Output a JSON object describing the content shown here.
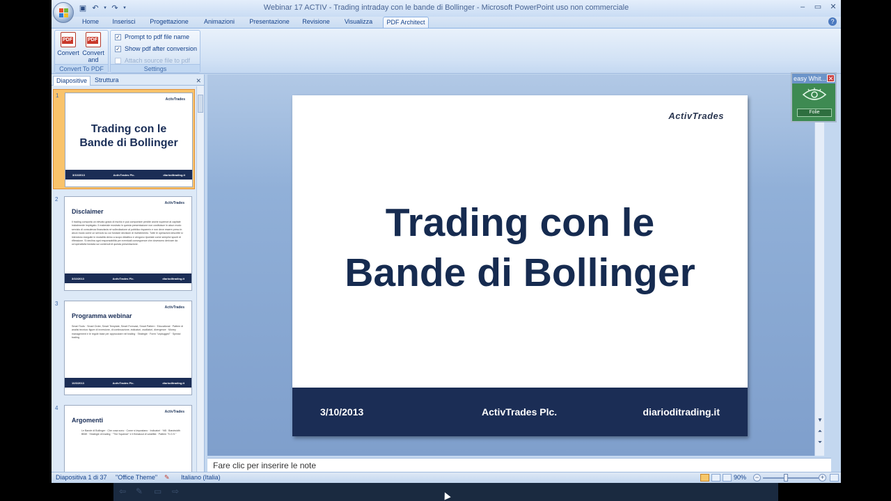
{
  "window": {
    "title": "Webinar 17  ACTIV - Trading intraday con le bande di Bollinger - Microsoft PowerPoint uso non commerciale"
  },
  "ribbon_tabs": [
    "Home",
    "Inserisci",
    "Progettazione",
    "Animazioni",
    "Presentazione",
    "Revisione",
    "Visualizza",
    "PDF Architect"
  ],
  "active_tab": "PDF Architect",
  "ribbon": {
    "convert_label": "Convert",
    "convert_mail_label": "Convert and Mail",
    "group1_label": "Convert To PDF",
    "checks": [
      {
        "label": "Prompt to pdf file name",
        "checked": true,
        "enabled": true
      },
      {
        "label": "Show pdf after conversion",
        "checked": true,
        "enabled": true
      },
      {
        "label": "Attach source file to pdf",
        "checked": false,
        "enabled": false
      }
    ],
    "group2_label": "Settings"
  },
  "left_pane": {
    "tabs": [
      "Diapositive",
      "Struttura"
    ],
    "thumbnails": [
      {
        "num": "1",
        "kind": "title",
        "title": "Trading con le Bande di Bollinger",
        "date": "3/10/2013",
        "company": "ActivTrades Plc.",
        "site": "diarioditrading.it"
      },
      {
        "num": "2",
        "kind": "text",
        "title": "Disclaimer",
        "body": "Il trading comporta un elevato grado di rischio e può comportare perdite anche superiori al capitale inizialmente impiegato. Il materiale mostrato in questa presentazione non costituisce in alcun modo servizio di consulenza finanziaria né sollecitazione al pubblico risparmio e non deve essere preso in alcun modo come un servizio su cui fondare decisioni di investimento. Tutte le operazioni descritte si intendono eseguite in modalità demo a scopo didattico e vengono riportate come semplici spunti di riflessione. Si declina ogni responsabilità per eventuali conseguenze che dovessero derivare da un'operatività fondata sui contenuti di questa presentazione.",
        "date": "3/10/2013",
        "company": "ActivTrades Plc.",
        "site": "diarioditrading.it"
      },
      {
        "num": "3",
        "kind": "text",
        "title": "Programma webinar",
        "body": "Smart Tools · Smart Order, Smart Template, Smart Forecast, Smart Pattern · Educational · Pattern di analisi tecnica: figure di inversione, di continuazione, indicatori, oscillatori, divergenze · Money management e le regole base per approcciare nel trading · Strategie · Forex \"unplugged\" · Spread trading",
        "date": "10/3/2013",
        "company": "ActivTrades Plc.",
        "site": "diarioditrading.it"
      },
      {
        "num": "4",
        "kind": "text",
        "title": "Argomenti",
        "body": "Le Bande di Bollinger · Che cosa sono · Come si impostano · Indicatori · %B · Bandwidth BBW · Strategie di trading · \"The Squeeze\" e il Breakout di volatilità · Pattern \"S.O.S.\"",
        "date": "",
        "company": "",
        "site": ""
      }
    ],
    "thumb_logo": "ActivTrades"
  },
  "slide": {
    "logo": "ActivTrades",
    "title_line1": "Trading con le",
    "title_line2": "Bande di Bollinger",
    "footer_date": "3/10/2013",
    "footer_company": "ActivTrades Plc.",
    "footer_site": "diarioditrading.it"
  },
  "notes_placeholder": "Fare clic per inserire le note",
  "status": {
    "slide_counter": "Diapositiva 1 di 37",
    "theme": "\"Office Theme\"",
    "language": "Italiano (Italia)",
    "zoom": "90%"
  },
  "widget": {
    "title": "easy Whit...",
    "button": "Folie"
  }
}
